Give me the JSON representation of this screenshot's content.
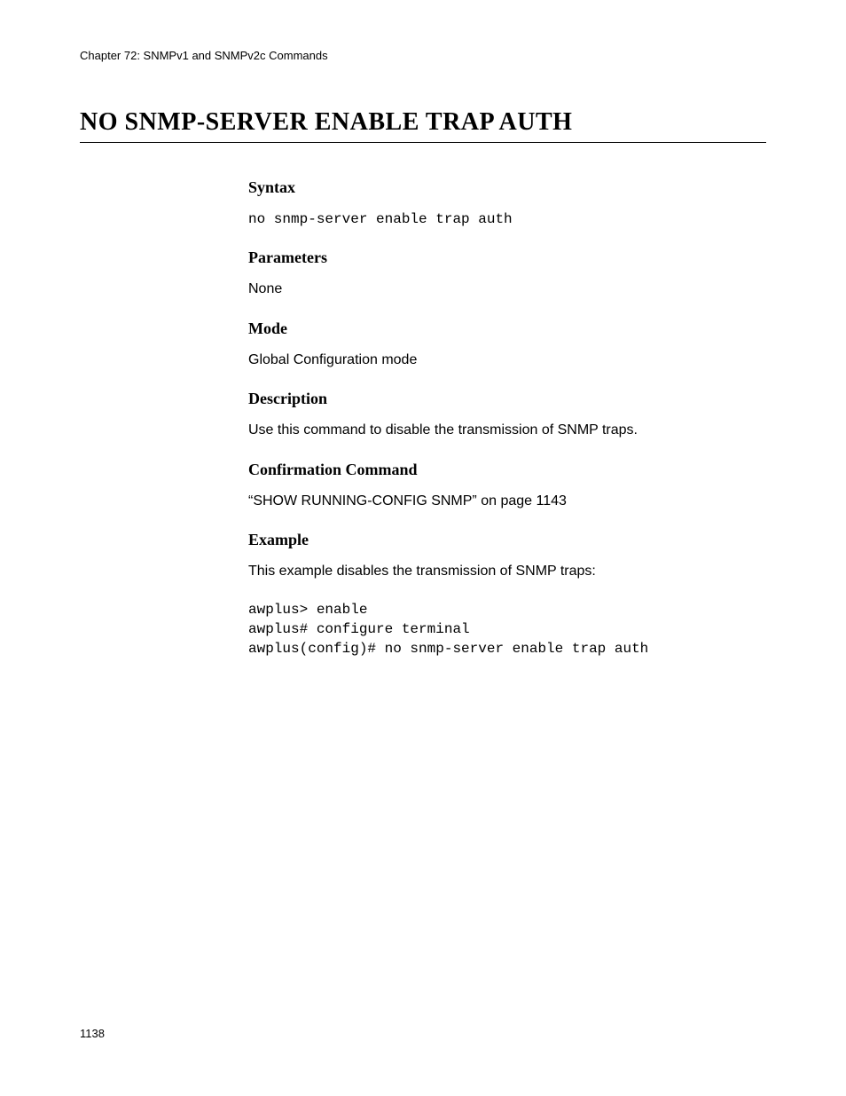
{
  "header": {
    "chapter": "Chapter 72: SNMPv1 and SNMPv2c Commands"
  },
  "title": "NO SNMP-SERVER ENABLE TRAP AUTH",
  "sections": {
    "syntax": {
      "heading": "Syntax",
      "code": "no snmp-server enable trap auth"
    },
    "parameters": {
      "heading": "Parameters",
      "text": "None"
    },
    "mode": {
      "heading": "Mode",
      "text": "Global Configuration mode"
    },
    "description": {
      "heading": "Description",
      "text": "Use this command to disable the transmission of SNMP traps."
    },
    "confirmation": {
      "heading": "Confirmation Command",
      "text": "“SHOW RUNNING-CONFIG SNMP” on page 1143"
    },
    "example": {
      "heading": "Example",
      "intro": "This example disables the transmission of SNMP traps:",
      "code": "awplus> enable\nawplus# configure terminal\nawplus(config)# no snmp-server enable trap auth"
    }
  },
  "footer": {
    "page_number": "1138"
  }
}
